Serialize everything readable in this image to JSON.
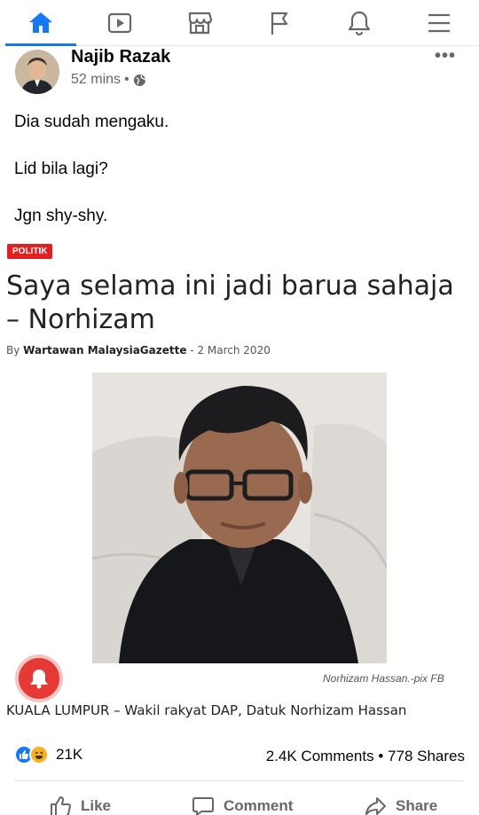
{
  "nav": {
    "items": [
      {
        "name": "home",
        "active": true
      },
      {
        "name": "watch",
        "active": false
      },
      {
        "name": "marketplace",
        "active": false
      },
      {
        "name": "pages",
        "active": false
      },
      {
        "name": "notifications",
        "active": false
      },
      {
        "name": "menu",
        "active": false
      }
    ],
    "accent": "#1877f2"
  },
  "post": {
    "author": "Najib Razak",
    "time": "52 mins",
    "visibility_icon": "globe-icon",
    "more": "•••",
    "lines": [
      "Dia sudah mengaku.",
      "Lid bila lagi?",
      "Jgn shy-shy."
    ]
  },
  "article": {
    "tag": "POLITIK",
    "headline": "Saya selama ini jadi barua sahaja – Norhizam",
    "byline_prefix": "By",
    "byline_author": "Wartawan MalaysiaGazette",
    "byline_date": " -  2 March 2020",
    "photo_credit": "Norhizam Hassan.-pix FB",
    "text": "KUALA LUMPUR – Wakil rakyat DAP, Datuk Norhizam Hassan"
  },
  "stats": {
    "reactions": "21K",
    "comments": "2.4K Comments",
    "separator": "•",
    "shares": "778 Shares"
  },
  "actions": {
    "like": "Like",
    "comment": "Comment",
    "share": "Share"
  }
}
